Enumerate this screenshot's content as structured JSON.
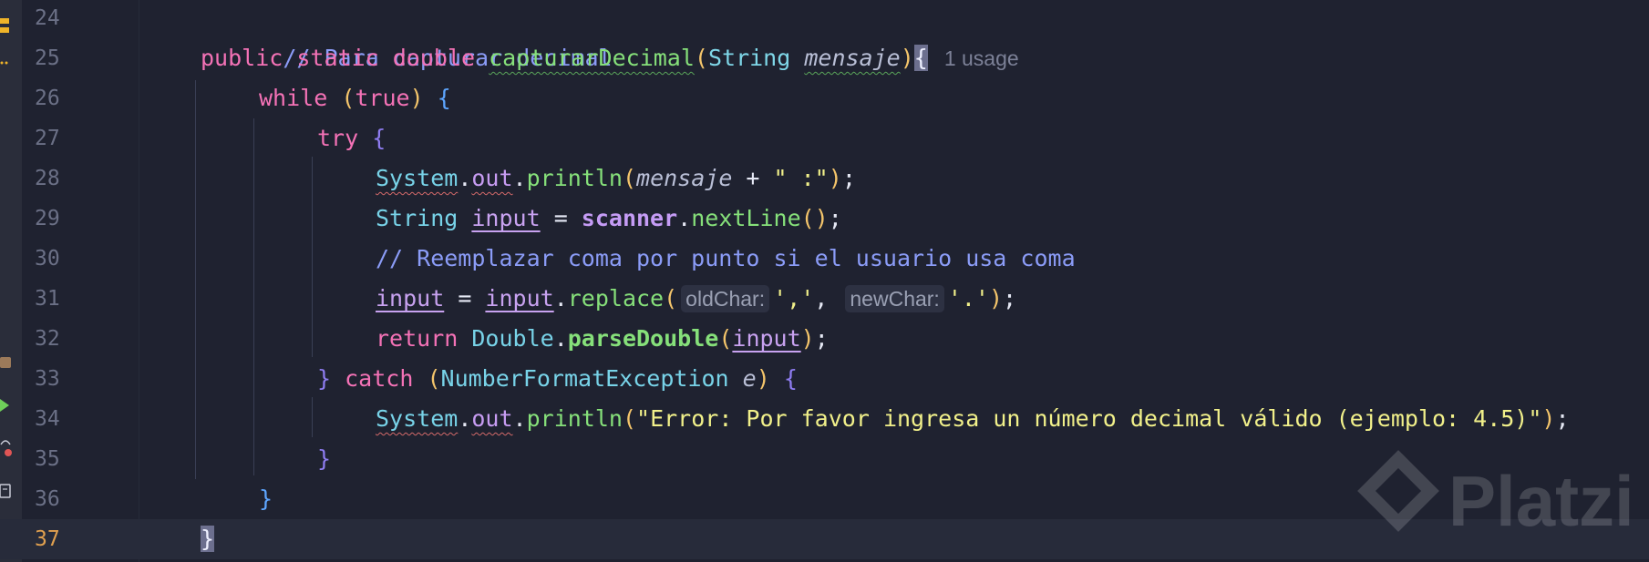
{
  "line_numbers": [
    "24",
    "25",
    "26",
    "27",
    "28",
    "29",
    "30",
    "31",
    "32",
    "33",
    "34",
    "35",
    "36",
    "37"
  ],
  "current_line": "37",
  "code": {
    "l24": {
      "comment": "// Para capturar decimal"
    },
    "l25": {
      "kw_public": "public",
      "kw_static": "static",
      "kw_double": "double",
      "method": "capturarDecimal",
      "paren_open": "(",
      "type_string": "String",
      "param": "mensaje",
      "paren_close": ")",
      "brace": "{",
      "usage_hint": "1 usage"
    },
    "l26": {
      "kw_while": "while",
      "paren_open": "(",
      "kw_true": "true",
      "paren_close": ")",
      "brace": "{"
    },
    "l27": {
      "kw_try": "try",
      "brace": "{"
    },
    "l28": {
      "system": "System",
      "dot1": ".",
      "out": "out",
      "dot2": ".",
      "println": "println",
      "paren_open": "(",
      "param": "mensaje",
      "plus": " + ",
      "string": "\" :\"",
      "paren_close": ")",
      "semi": ";"
    },
    "l29": {
      "type_string": "String",
      "var": "input",
      "eq": " = ",
      "scanner": "scanner",
      "dot": ".",
      "method": "nextLine",
      "parens": "()",
      "semi": ";"
    },
    "l30": {
      "comment": "// Reemplazar coma por punto si el usuario usa coma"
    },
    "l31": {
      "var1": "input",
      "eq": " = ",
      "var2": "input",
      "dot": ".",
      "method": "replace",
      "paren_open": "(",
      "hint1": "oldChar:",
      "arg1": "','",
      "comma": ",",
      "hint2": "newChar:",
      "arg2": "'.'",
      "paren_close": ")",
      "semi": ";"
    },
    "l32": {
      "kw_return": "return",
      "type_double": "Double",
      "dot": ".",
      "method": "parseDouble",
      "paren_open": "(",
      "var": "input",
      "paren_close": ")",
      "semi": ";"
    },
    "l33": {
      "brace_close": "}",
      "kw_catch": "catch",
      "paren_open": "(",
      "exception": "NumberFormatException",
      "var_e": "e",
      "paren_close": ")",
      "brace": "{"
    },
    "l34": {
      "system": "System",
      "dot1": ".",
      "out": "out",
      "dot2": ".",
      "println": "println",
      "paren_open": "(",
      "string": "\"Error: Por favor ingresa un número decimal válido (ejemplo: 4.5)\"",
      "paren_close": ")",
      "semi": ";"
    },
    "l35": {
      "brace": "}"
    },
    "l36": {
      "brace": "}"
    },
    "l37": {
      "brace": "}"
    }
  },
  "watermark": {
    "text": "Platzi"
  },
  "colors": {
    "background": "#1f2230",
    "keyword": "#f472b6",
    "comment": "#8b9cf7",
    "function": "#86e07a",
    "string": "#f1f08a",
    "type": "#7fd7e8",
    "current_line_number": "#e0a04f"
  }
}
